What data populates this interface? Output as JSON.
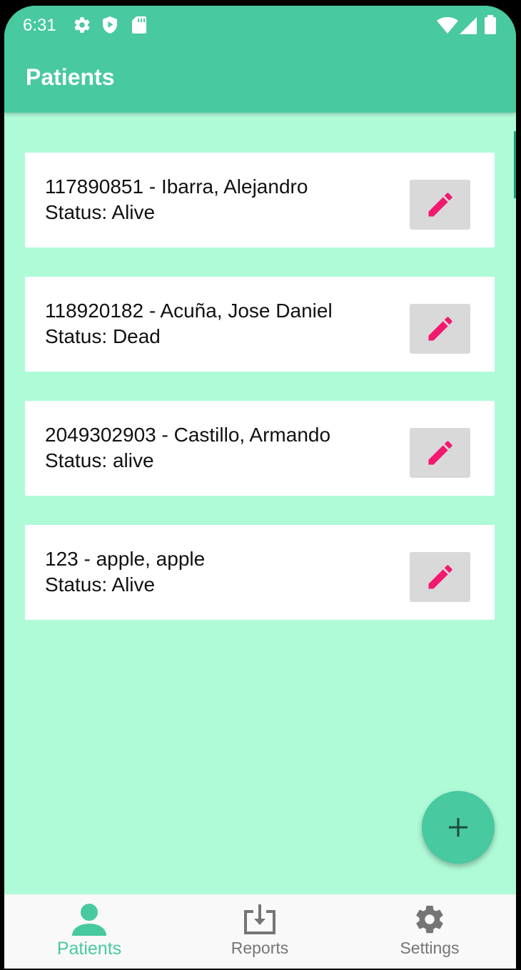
{
  "status_bar": {
    "time": "6:31",
    "icons": [
      "settings-icon",
      "shield-play-icon",
      "sd-card-icon",
      "wifi-icon",
      "signal-icon",
      "battery-icon"
    ]
  },
  "app_bar": {
    "title": "Patients"
  },
  "patients": [
    {
      "line1": "117890851 - Ibarra, Alejandro",
      "status_label": "Status: Alive"
    },
    {
      "line1": "118920182 - Acuña, Jose Daniel",
      "status_label": "Status: Dead"
    },
    {
      "line1": "2049302903 - Castillo, Armando",
      "status_label": "Status: alive"
    },
    {
      "line1": "123 - apple, apple",
      "status_label": "Status: Alive"
    }
  ],
  "fab": {
    "icon": "plus-icon"
  },
  "bottom_nav": {
    "items": [
      {
        "label": "Patients",
        "icon": "person-icon",
        "active": true
      },
      {
        "label": "Reports",
        "icon": "download-tray-icon",
        "active": false
      },
      {
        "label": "Settings",
        "icon": "gear-icon",
        "active": false
      }
    ]
  },
  "colors": {
    "primary": "#48C9A0",
    "background": "#AFFBD8",
    "edit_icon": "#F2196F",
    "nav_inactive": "#757575"
  }
}
